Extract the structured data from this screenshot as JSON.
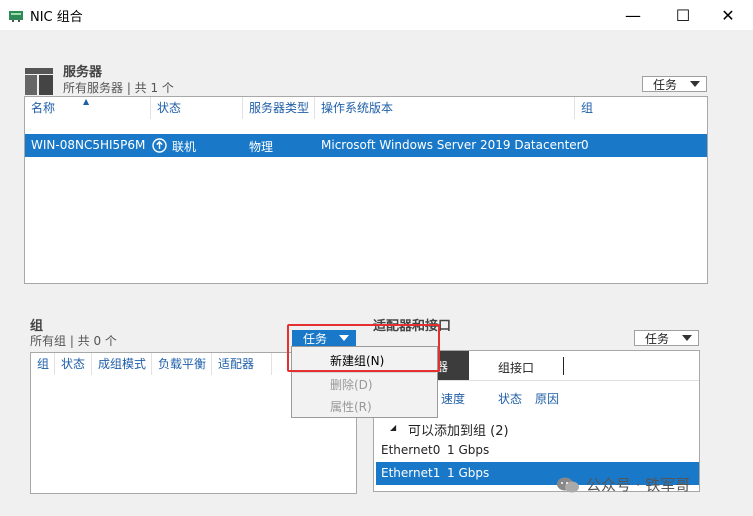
{
  "window": {
    "title": "NIC 组合",
    "minimize_glyph": "—",
    "maximize_glyph": "☐",
    "close_glyph": "✕"
  },
  "servers": {
    "title": "服务器",
    "subtitle": "所有服务器 | 共 1 个",
    "tasks_label": "任务",
    "columns": [
      "名称",
      "状态",
      "服务器类型",
      "操作系统版本",
      "组"
    ],
    "rows": [
      {
        "name": "WIN-08NC5HI5P6M",
        "status": "联机",
        "type": "物理",
        "os": "Microsoft Windows Server 2019 Datacenter",
        "groups": "0"
      }
    ]
  },
  "teams": {
    "title": "组",
    "subtitle": "所有组 | 共 0 个",
    "tasks_label": "任务",
    "columns": [
      "组",
      "状态",
      "成组模式",
      "负载平衡",
      "适配器"
    ]
  },
  "task_menu": {
    "items": [
      {
        "label": "新建组(N)",
        "enabled": true
      },
      {
        "label": "删除(D)",
        "enabled": false
      },
      {
        "label": "属性(R)",
        "enabled": false
      }
    ]
  },
  "adapters": {
    "title": "适配器和接口",
    "tasks_label": "任务",
    "tab_left_visible": "器",
    "tab_right": "组接口",
    "columns": [
      "速度",
      "状态",
      "原因"
    ],
    "group_label": "可以添加到组 (2)",
    "rows": [
      {
        "name": "Ethernet0",
        "speed": "1 Gbps",
        "selected": false
      },
      {
        "name": "Ethernet1",
        "speed": "1 Gbps",
        "selected": true
      }
    ]
  },
  "watermark": "公众号 · 铁军哥",
  "colors": {
    "selection": "#1979c8",
    "highlight_box": "#e53030",
    "header_text": "#1f5fa8"
  }
}
